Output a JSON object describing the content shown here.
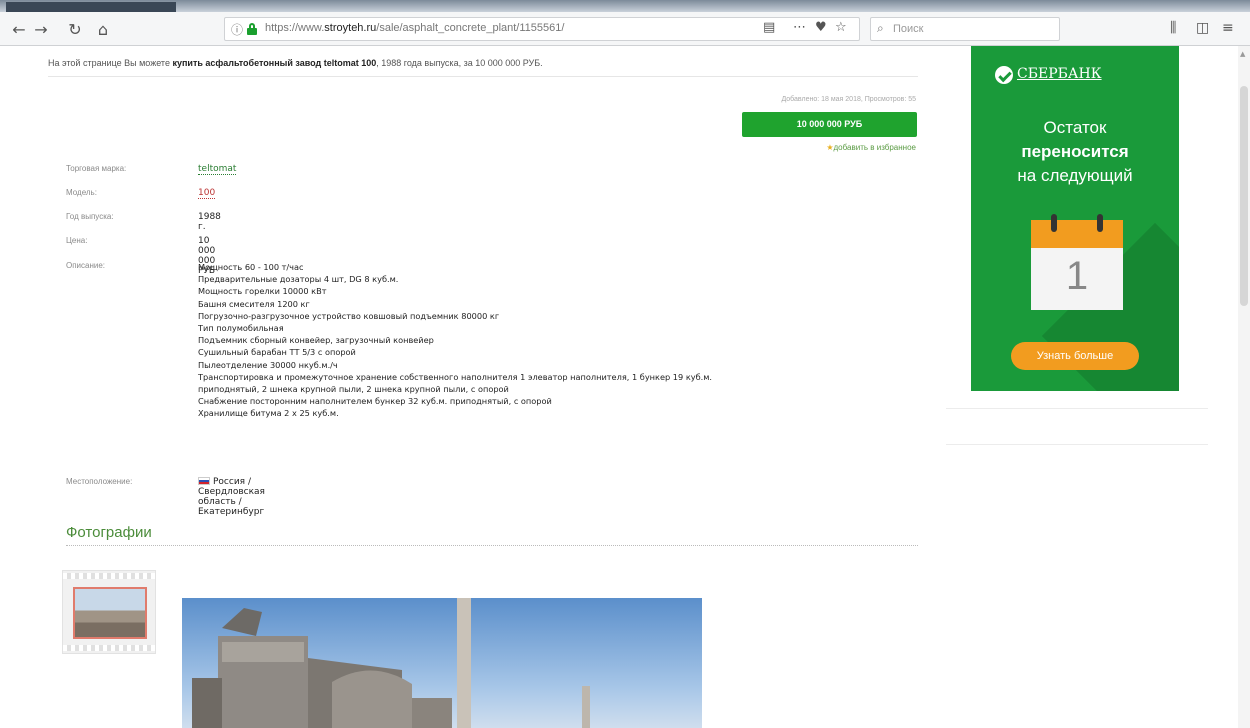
{
  "browser": {
    "url_prefix": "https://www.",
    "url_domain": "stroyteh.ru",
    "url_path": "/sale/asphalt_concrete_plant/1155561/",
    "search_placeholder": "Поиск"
  },
  "intro": {
    "before": "На этой странице Вы можете ",
    "bold": "купить асфальтобетонный завод teltomat 100",
    "after": ", 1988 года выпуска, за 10 000 000 РУБ."
  },
  "meta": {
    "added": "Добавлено: 18 мая 2018, Просмотров: 55"
  },
  "price_button": "10 000 000 РУБ",
  "favorite": "добавить в избранное",
  "props": {
    "brand_label": "Торговая марка:",
    "brand_value": "teltomat",
    "model_label": "Модель:",
    "model_value": "100",
    "year_label": "Год выпуска:",
    "year_value": "1988 г.",
    "price_label": "Цена:",
    "price_value": "10 000 000 РУБ",
    "desc_label": "Описание:",
    "desc_lines": [
      "Мощность 60 - 100 т/час",
      "Предварительные дозаторы 4 шт, DG 8 куб.м.",
      "Мощность горелки 10000 кВт",
      "Башня смесителя 1200 кг",
      "Погрузочно-разгрузочное устройство ковшовый подъемник 80000 кг",
      "Тип полумобильная",
      "Подъемник сборный конвейер, загрузочный конвейер",
      "Сушильный барабан ТТ 5/3 с опорой",
      "Пылеотделение 30000 нкуб.м./ч",
      "Транспортировка и промежуточное хранение собственного наполнителя 1 элеватор наполнителя, 1 бункер 19 куб.м.",
      "приподнятый, 2 шнека крупной пыли, 2 шнека крупной пыли, с опорой",
      "Снабжение посторонним наполнителем бункер 32 куб.м. приподнятый, с опорой",
      "Хранилище битума 2 х 25 куб.м."
    ],
    "location_label": "Местоположение:",
    "location_value": "Россия / Свердловская область / Екатеринбург"
  },
  "photos_title": "Фотографии",
  "ad": {
    "brand": "СБЕРБАНК",
    "line1": "Остаток",
    "line2": "переносится",
    "line3": "на следующий",
    "calendar_number": "1",
    "button": "Узнать больше"
  },
  "colors": {
    "accent_green": "#1fa32e",
    "ad_green": "#1a9a3a",
    "ad_orange": "#f29c1f"
  }
}
